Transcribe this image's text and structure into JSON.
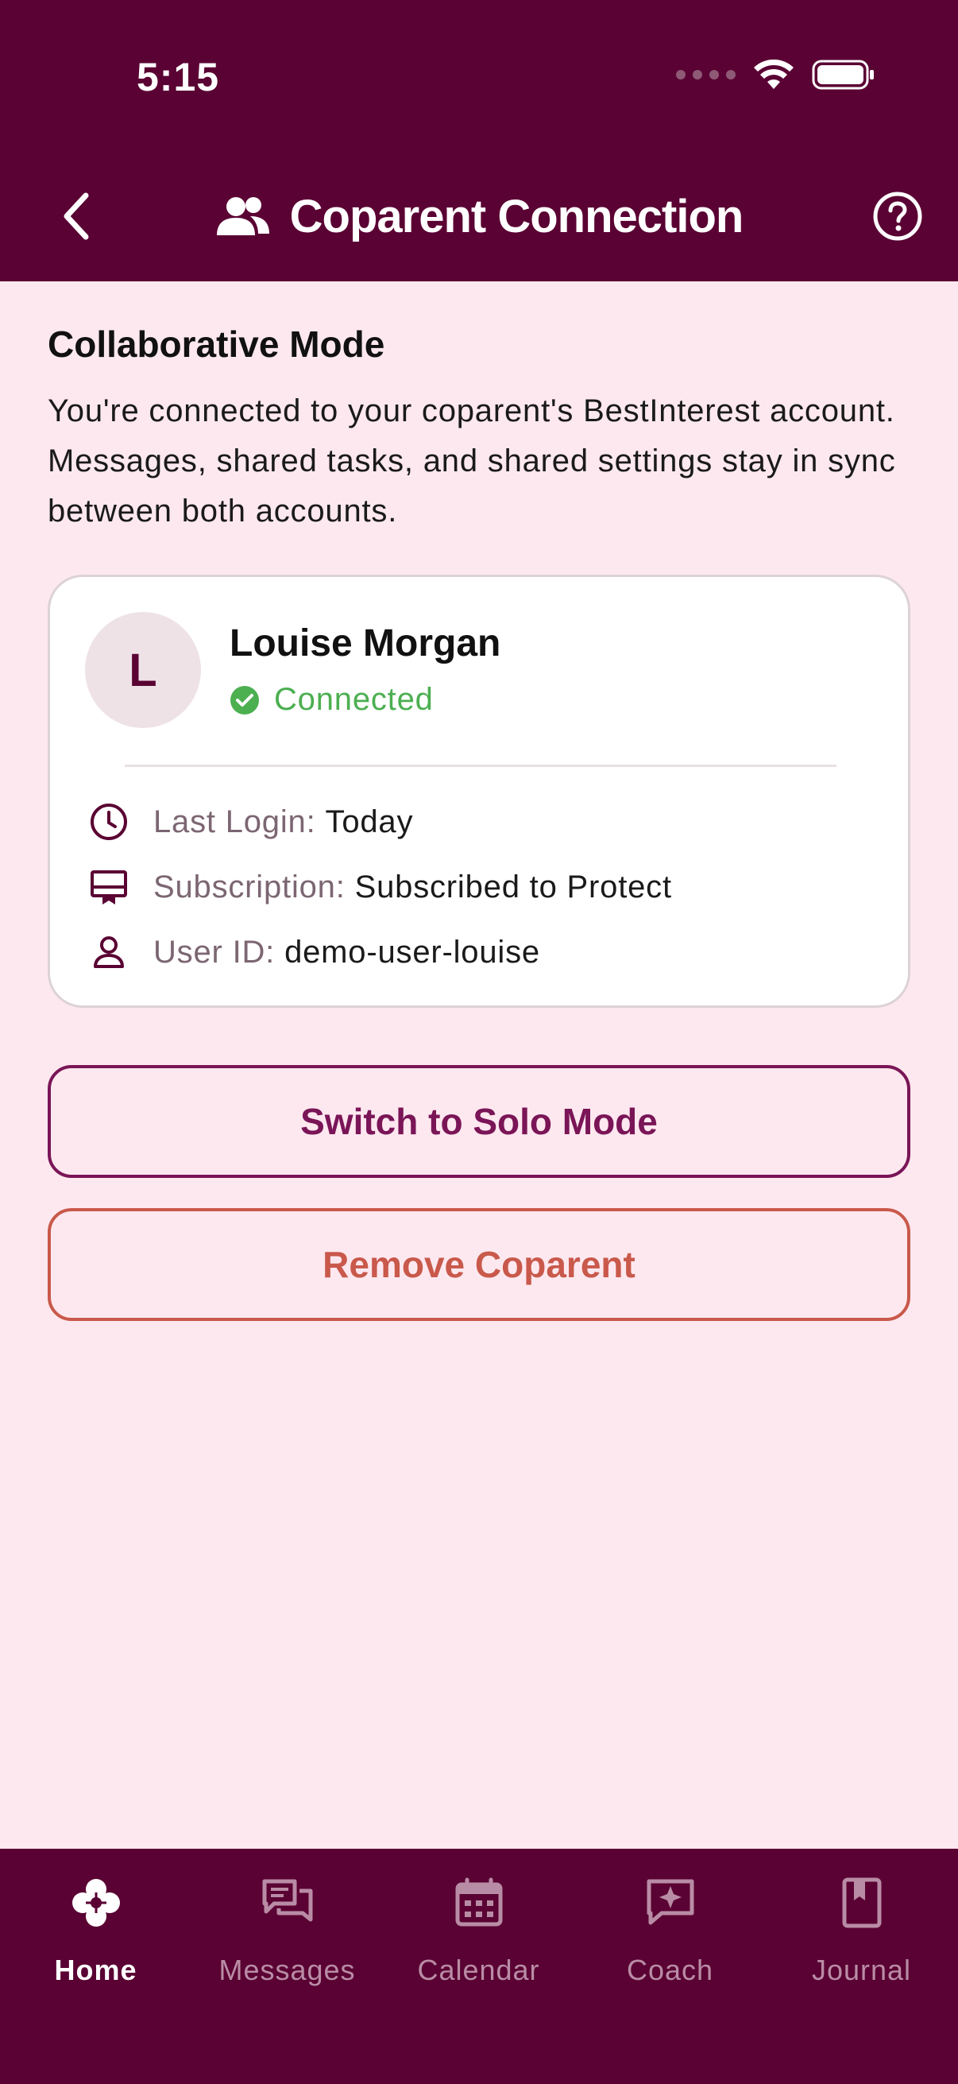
{
  "status_bar": {
    "time": "5:15"
  },
  "header": {
    "title": "Coparent Connection"
  },
  "section": {
    "title": "Collaborative Mode",
    "description": "You're connected to your coparent's BestInterest account. Messages, shared tasks, and shared settings stay in sync between both accounts."
  },
  "coparent": {
    "initial": "L",
    "name": "Louise Morgan",
    "status": "Connected",
    "details": [
      {
        "icon": "clock-icon",
        "label": "Last Login:",
        "value": "Today"
      },
      {
        "icon": "subscription-icon",
        "label": "Subscription:",
        "value": "Subscribed to Protect"
      },
      {
        "icon": "person-icon",
        "label": "User ID:",
        "value": "demo-user-louise"
      }
    ]
  },
  "actions": {
    "switch_solo": "Switch to Solo Mode",
    "remove_coparent": "Remove Coparent"
  },
  "nav": {
    "items": [
      {
        "label": "Home",
        "icon": "clover-icon",
        "active": true
      },
      {
        "label": "Messages",
        "icon": "messages-icon",
        "active": false
      },
      {
        "label": "Calendar",
        "icon": "calendar-icon",
        "active": false
      },
      {
        "label": "Coach",
        "icon": "coach-sparkle-icon",
        "active": false
      },
      {
        "label": "Journal",
        "icon": "journal-icon",
        "active": false
      }
    ]
  },
  "colors": {
    "brand": "#5a0233",
    "background": "#fde8ef",
    "connected": "#4caf50",
    "primary_outline": "#7a1557",
    "danger_outline": "#c9594b"
  }
}
